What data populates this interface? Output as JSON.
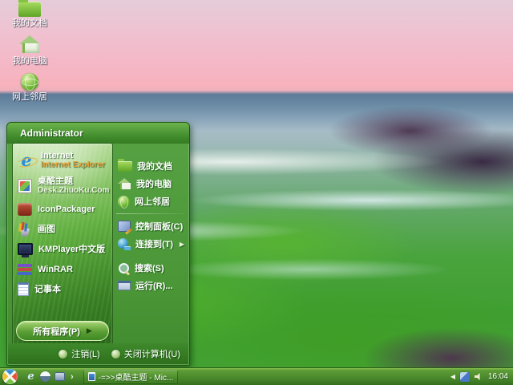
{
  "desktop": {
    "icons": [
      {
        "label": "我的文档"
      },
      {
        "label": "我的电脑"
      },
      {
        "label": "网上邻居"
      }
    ]
  },
  "start_menu": {
    "username": "Administrator",
    "left_items": [
      {
        "label": "Internet",
        "sublabel": "Internet Explorer"
      },
      {
        "label": "桌酷主题",
        "sublabel": "Desk.ZhuoKu.Com"
      },
      {
        "label": "IconPackager"
      },
      {
        "label": "画图"
      },
      {
        "label": "KMPlayer中文版"
      },
      {
        "label": "WinRAR"
      },
      {
        "label": "记事本"
      }
    ],
    "all_programs_label": "所有程序(P)",
    "right_items": [
      {
        "label": "我的文档"
      },
      {
        "label": "我的电脑"
      },
      {
        "label": "网上邻居"
      },
      {
        "label": "控制面板(C)"
      },
      {
        "label": "连接到(T)"
      },
      {
        "label": "搜索(S)"
      },
      {
        "label": "运行(R)..."
      }
    ],
    "logoff_label": "注销(L)",
    "shutdown_label": "关闭计算机(U)"
  },
  "taskbar": {
    "task_button_title": "-=>>桌酷主题 - Mic...",
    "clock": "16:04"
  },
  "icons": {
    "ie_letter": "e",
    "submenu_arrow": "▶",
    "all_programs_arrow": "▶",
    "quick_launch_overflow": "›",
    "tray_collapse": "◀"
  },
  "colors": {
    "menu_green": "#4a9637",
    "menu_header_green": "#3f8a2b",
    "taskbar_green": "#4b8a2c",
    "sky_pink": "#f4b8c7",
    "sea_blue": "#6f8fa8",
    "moss_green": "#4aa43e",
    "text_white": "#ffffff"
  }
}
